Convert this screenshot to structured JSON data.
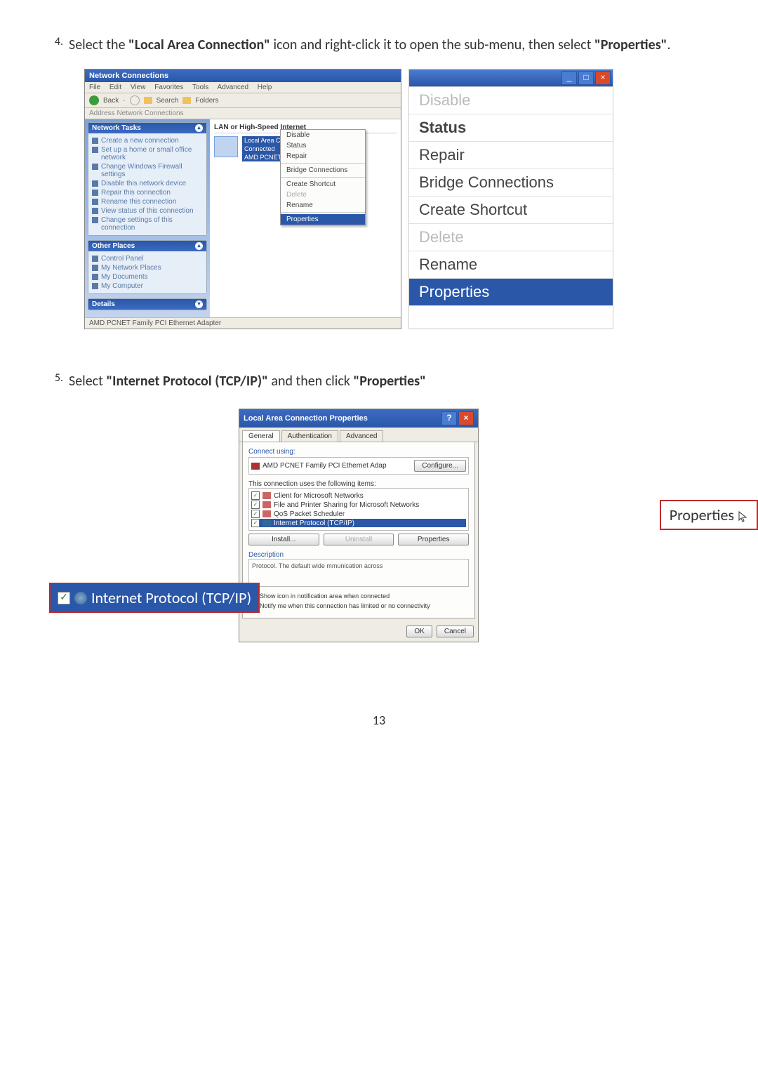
{
  "step4": {
    "num": "4.",
    "text_a": "Select the ",
    "text_b": "\"Local Area Connection\"",
    "text_c": " icon and right-click it to open the sub-menu, then select ",
    "text_d": "\"Properties\"",
    "text_e": "."
  },
  "win1": {
    "title": "Network Connections",
    "menu": [
      "File",
      "Edit",
      "View",
      "Favorites",
      "Tools",
      "Advanced",
      "Help"
    ],
    "toolbar": {
      "back": "Back",
      "search": "Search",
      "folders": "Folders"
    },
    "address": "Address Network Connections",
    "panel_tasks_head": "Network Tasks",
    "task_links": [
      "Create a new connection",
      "Set up a home or small office network",
      "Change Windows Firewall settings",
      "Disable this network device",
      "Repair this connection",
      "Rename this connection",
      "View status of this connection",
      "Change settings of this connection"
    ],
    "panel_other_head": "Other Places",
    "other_links": [
      "Control Panel",
      "My Network Places",
      "My Documents",
      "My Computer"
    ],
    "panel_details_head": "Details",
    "main_heading": "LAN or High-Speed Internet",
    "conn_name": "Local Area Connection",
    "conn_state": "Connected",
    "conn_device": "AMD PCNET",
    "ctx": [
      "Disable",
      "Status",
      "Repair",
      "Bridge Connections",
      "Create Shortcut",
      "Delete",
      "Rename",
      "Properties"
    ],
    "statusbar": "AMD PCNET Family PCI Ethernet Adapter"
  },
  "callout1": {
    "items": [
      {
        "label": "Disable",
        "style": "disabled"
      },
      {
        "label": "Status",
        "style": "status"
      },
      {
        "label": "Repair",
        "style": ""
      },
      {
        "label": "Bridge Connections",
        "style": ""
      },
      {
        "label": "Create Shortcut",
        "style": ""
      },
      {
        "label": "Delete",
        "style": "disabled"
      },
      {
        "label": "Rename",
        "style": ""
      },
      {
        "label": "Properties",
        "style": "prop"
      }
    ]
  },
  "step5": {
    "num": "5.",
    "text_a": "Select ",
    "text_b": "\"Internet Protocol (TCP/IP)\"",
    "text_c": " and then click ",
    "text_d": "\"Properties\""
  },
  "win2": {
    "title": "Local Area Connection Properties",
    "tabs": [
      "General",
      "Authentication",
      "Advanced"
    ],
    "connect_using_lbl": "Connect using:",
    "adapter": "AMD PCNET Family PCI Ethernet Adap",
    "configure_btn": "Configure...",
    "items_lbl": "This connection uses the following items:",
    "items": [
      "Client for Microsoft Networks",
      "File and Printer Sharing for Microsoft Networks",
      "QoS Packet Scheduler",
      "Internet Protocol (TCP/IP)"
    ],
    "install_btn": "Install...",
    "uninstall_btn": "Uninstall",
    "properties_btn": "Properties",
    "desc_head": "Description",
    "desc_text": "Protocol. The default wide mmunication across",
    "chk1": "Show icon in notification area when connected",
    "chk2": "Notify me when this connection has limited or no connectivity",
    "ok": "OK",
    "cancel": "Cancel"
  },
  "tcpip_callout": "Internet Protocol (TCP/IP)",
  "prop_callout": "Properties",
  "page_num": "13"
}
